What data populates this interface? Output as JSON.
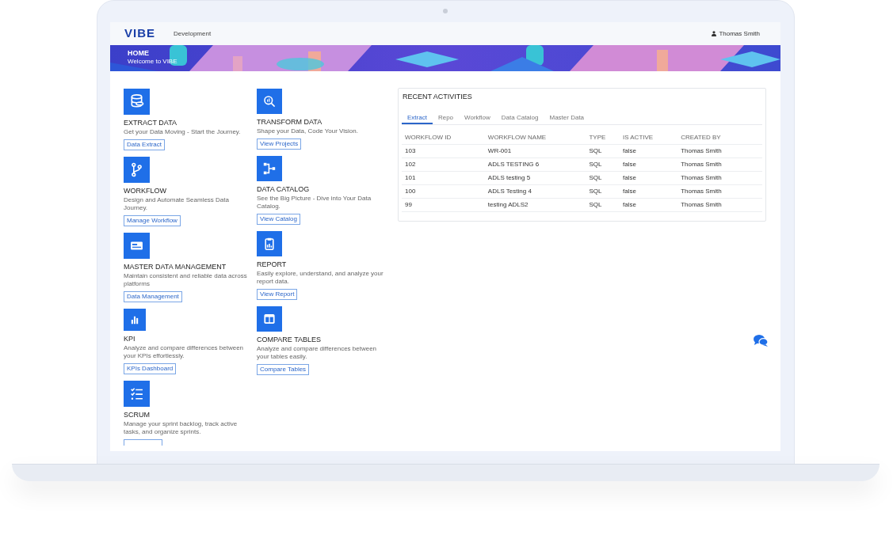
{
  "header": {
    "logo": "VIBE",
    "environment": "Development",
    "user": "Thomas Smith"
  },
  "banner": {
    "title": "HOME",
    "subtitle": "Welcome to VIBE"
  },
  "module_columns": [
    [
      {
        "title": "EXTRACT DATA",
        "description": "Get your Data Moving - Start the Journey.",
        "button": "Data Extract"
      },
      {
        "title": "WORKFLOW",
        "description": "Design and Automate Seamless Data Journey.",
        "button": "Manage Workflow"
      },
      {
        "title": "MASTER DATA MANAGEMENT",
        "description": "Maintain consistent and reliable data across platforms",
        "button": "Data Management"
      },
      {
        "title": "KPI",
        "description": "Analyze and compare differences between your KPIs effortlessly.",
        "button": "KPIs Dashboard"
      },
      {
        "title": "SCRUM",
        "description": "Manage your sprint backlog, track active tasks, and organize sprints."
      }
    ],
    [
      {
        "title": "TRANSFORM DATA",
        "description": "Shape your Data, Code Your Vision.",
        "button": "View Projects"
      },
      {
        "title": "DATA CATALOG",
        "description": "See the Big Picture - Dive into Your Data Catalog.",
        "button": "View Catalog"
      },
      {
        "title": "REPORT",
        "description": "Easily explore, understand, and analyze your report data.",
        "button": "View Report"
      },
      {
        "title": "COMPARE TABLES",
        "description": "Analyze and compare differences between your tables easily.",
        "button": "Compare Tables"
      }
    ]
  ],
  "recent_activities": {
    "title": "RECENT ACTIVITIES",
    "tabs": [
      {
        "label": "Extract",
        "selected": true
      },
      {
        "label": "Repo",
        "selected": false
      },
      {
        "label": "Workflow",
        "selected": false
      },
      {
        "label": "Data Catalog",
        "selected": false
      },
      {
        "label": "Master Data",
        "selected": false
      }
    ],
    "columns": [
      "WORKFLOW ID",
      "WORKFLOW NAME",
      "TYPE",
      "IS ACTIVE",
      "CREATED BY"
    ],
    "rows": [
      [
        "103",
        "WR-001",
        "SQL",
        "false",
        "Thomas Smith"
      ],
      [
        "102",
        "ADLS TESTING 6",
        "SQL",
        "false",
        "Thomas Smith"
      ],
      [
        "101",
        "ADLS testing 5",
        "SQL",
        "false",
        "Thomas Smith"
      ],
      [
        "100",
        "ADLS Testing 4",
        "SQL",
        "false",
        "Thomas Smith"
      ],
      [
        "99",
        "testing ADLS2",
        "SQL",
        "false",
        "Thomas Smith"
      ]
    ]
  }
}
